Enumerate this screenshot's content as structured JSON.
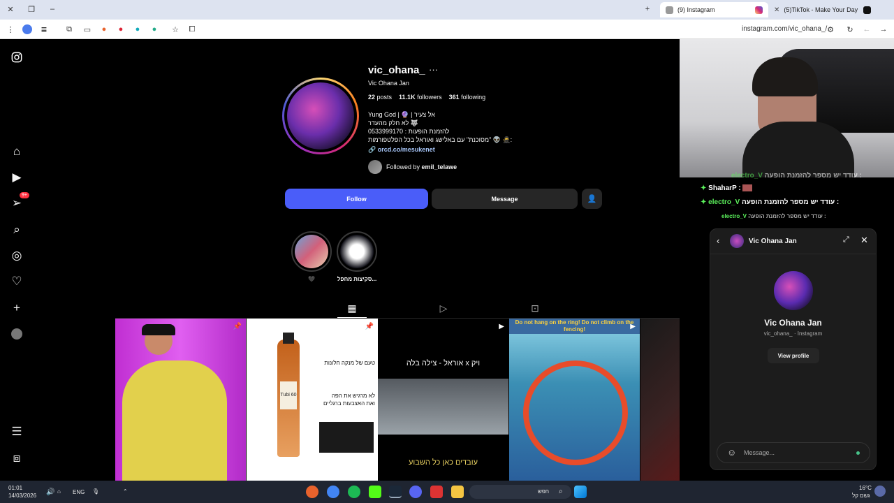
{
  "browser": {
    "tabs": [
      {
        "label": "(9) Instagram",
        "active": true
      },
      {
        "label": "(5)TikTok - Make Your Day",
        "active": false
      }
    ],
    "url": "instagram.com/vic_ohana_/"
  },
  "nav": {
    "notifications_badge": "9+"
  },
  "profile": {
    "username": "vic_ohana_",
    "more": "···",
    "full_name": "Vic Ohana Jan",
    "posts_count": "22",
    "posts_label": "posts",
    "followers_count": "11.1K",
    "followers_label": "followers",
    "following_count": "361",
    "following_label": "following",
    "bio": [
      "Yung God | 🔮 | אל צעיר",
      "🐺 לא חלק מהעדר",
      "להזמנת הופעות : 0533999170",
      ":🥷 👽 \"מסוכנת\" עם באלישג ואוראל בכל הפלטפורמות"
    ],
    "link": "orcd.co/mesukenet",
    "followed_by_prefix": "Followed by",
    "followed_by_user": "emil_telawe",
    "follow_button": "Follow",
    "message_button": "Message",
    "highlights": [
      {
        "label": "🖤"
      },
      {
        "label": "סקיצות מחפל..."
      }
    ]
  },
  "posts": [
    {
      "caption": ""
    },
    {
      "caption_lines": [
        "טעם של מנקה חלונות",
        "לא מרגיש את הפה",
        "ואת האצבעות ברגליים"
      ],
      "bottle": "Tubi 60"
    },
    {
      "caption_top": "ויק x אוראל - צילה בלה",
      "caption_bottom": "עובדים כאן כל השבוע"
    },
    {
      "sign": "Do not hang on the ring! Do not climb on the fencing!"
    },
    {
      "caption": ""
    }
  ],
  "stream_chat": [
    {
      "user": "electro_V",
      "text": "עודד יש מספר להזמנת הופעה :"
    },
    {
      "user": "ShaharP",
      "text": ":"
    },
    {
      "user": "electro_V",
      "text": "עודד יש מספר להזמנת הופעה :"
    },
    {
      "user": "electro_V",
      "text": "עודד יש מספר להזמנת הופעה :"
    }
  ],
  "dm": {
    "title": "Vic Ohana Jan",
    "name": "Vic Ohana Jan",
    "subtitle": "vic_ohana_ · Instagram",
    "view_profile": "View profile",
    "placeholder": "Message..."
  },
  "taskbar": {
    "time": "01:01",
    "date": "14/03/2026",
    "lang": "ENG",
    "search": "חפש",
    "weather_temp": "16°C",
    "weather_desc": "גשם קל"
  },
  "colors": {
    "follow": "#4a5df9",
    "surface": "#262626",
    "chat_name": "#5cf25c"
  }
}
